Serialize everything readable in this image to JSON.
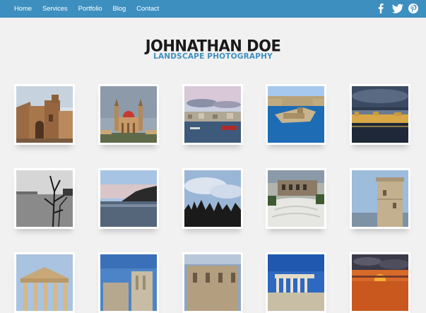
{
  "nav": {
    "items": [
      "Home",
      "Services",
      "Portfolio",
      "Blog",
      "Contact"
    ]
  },
  "social": {
    "icons": [
      "facebook-icon",
      "twitter-icon",
      "pinterest-icon"
    ]
  },
  "brand": {
    "name": "JOHNATHAN DOE",
    "tagline": "LANDSCAPE PHOTOGRAPHY"
  },
  "colors": {
    "nav_bar": "#3d8fbf",
    "accent": "#3d8fbf",
    "background": "#f1f1f1",
    "title": "#1a1a1a"
  },
  "gallery": {
    "photos": [
      "church-facade",
      "domed-church",
      "harbour-town",
      "fortified-harbour",
      "waterfront-sunset",
      "bare-tree-lake",
      "lake-dusk",
      "forest-clouds",
      "theatre-ruins",
      "stone-tower",
      "parthenon-columns",
      "ruins-blue-sky",
      "ancient-wall",
      "erechtheion",
      "sea-sunset"
    ]
  }
}
